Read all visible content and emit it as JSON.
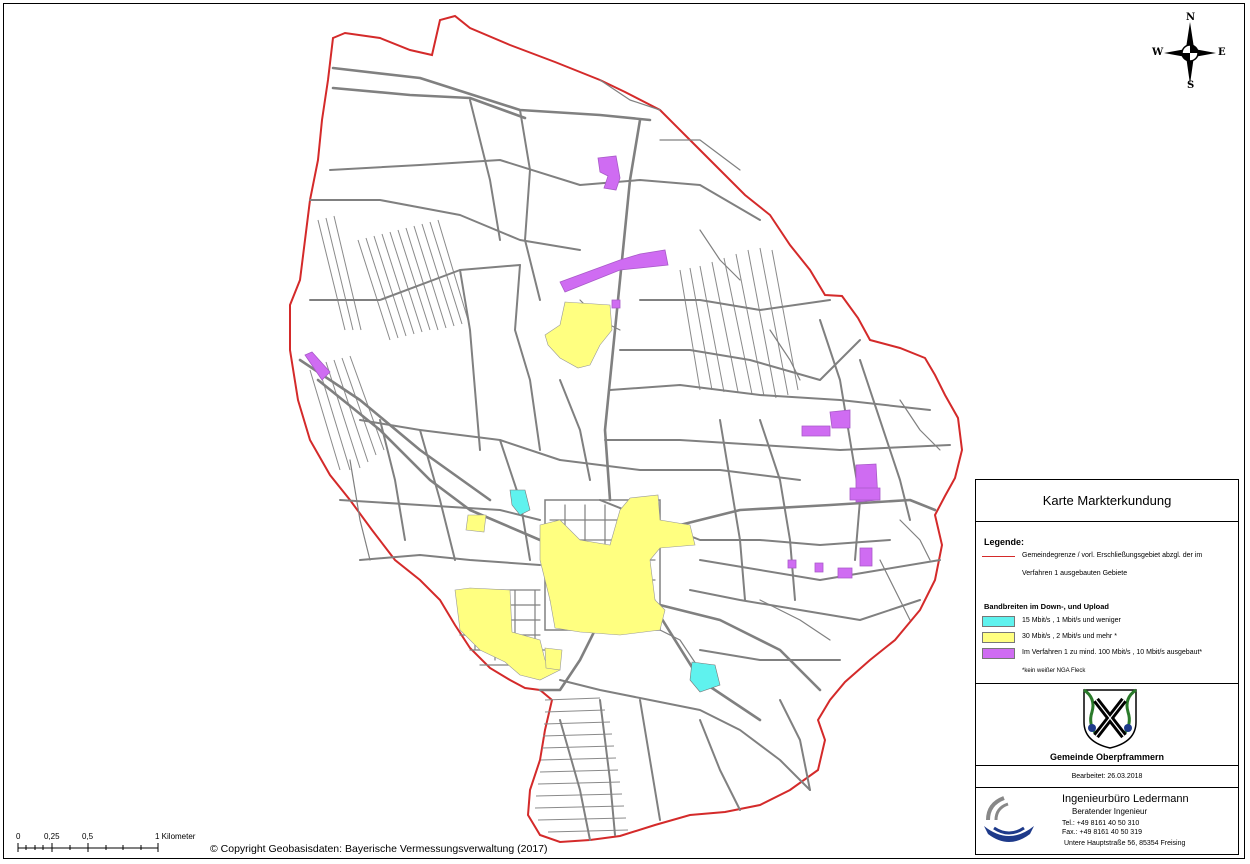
{
  "compass": {
    "n": "N",
    "s": "S",
    "e": "E",
    "w": "W"
  },
  "panel": {
    "title": "Karte Markterkundung",
    "legend_heading": "Legende:",
    "boundary_label_1": "Gemeindegrenze / vorl. Erschließungsgebiet abzgl. der im",
    "boundary_label_2": "Verfahren 1 ausgebauten Gebiete",
    "bandwidth_heading": "Bandbreiten im Down-, und Upload",
    "items": [
      {
        "label": "15 Mbit/s , 1 Mbit/s und weniger",
        "color": "#5ff2ee"
      },
      {
        "label": "30 Mbit/s , 2 Mbit/s  und mehr *",
        "color": "#ffff80"
      },
      {
        "label": "Im Verfahren 1 zu mind. 100 Mbit/s , 10 Mbit/s ausgebaut*",
        "color": "#cf6cf2"
      }
    ],
    "footnote": "*kein weißer NGA Fleck",
    "municipality": "Gemeinde Oberpframmern",
    "edited": "Bearbeitet: 26.03.2018",
    "firm_name": "Ingenieurbüro Ledermann",
    "firm_sub": "Beratender Ingenieur",
    "tel": "Tel.:  +49 8161 40 50 310",
    "fax": "Fax.: +49 8161 40 50 319",
    "address": "Untere Hauptstraße 56, 85354 Freising"
  },
  "scale": {
    "t0": "0",
    "t1": "0,25",
    "t2": "0,5",
    "t3": "1 Kilometer"
  },
  "copyright": "© Copyright Geobasisdaten: Bayerische Vermessungsverwaltung (2017)",
  "colors": {
    "boundary": "#d42a2a",
    "roads": "#808080"
  }
}
